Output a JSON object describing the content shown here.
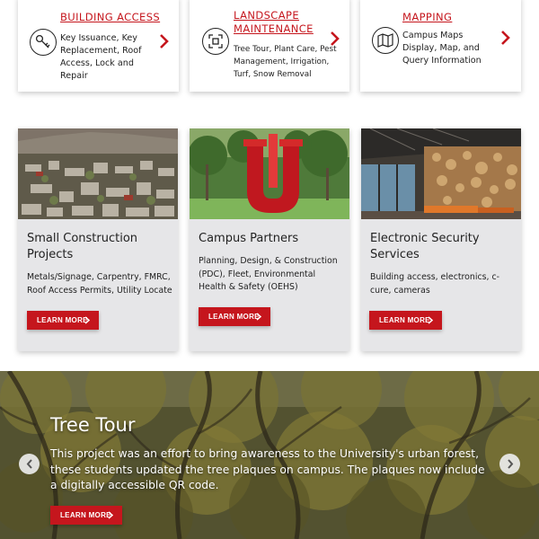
{
  "services": [
    {
      "title": "BUILDING ACCESS",
      "description": "Key Issuance, Key Replacement, Roof Access, Lock and Repair",
      "icon": "key-icon"
    },
    {
      "title": "LANDSCAPE MAINTENANCE",
      "description": "Tree Tour, Plant Care, Pest Management, Irrigation, Turf, Snow Removal",
      "icon": "focus-frame-icon"
    },
    {
      "title": "MAPPING",
      "description": "Campus Maps Display, Map, and Query Information",
      "icon": "map-icon"
    }
  ],
  "features": [
    {
      "title": "Small Construction Projects",
      "description": "Metals/Signage, Carpentry, FMRC, Roof Access Permits, Utility Locate",
      "button": "LEARN MORE"
    },
    {
      "title": "Campus Partners",
      "description": "Planning, Design, & Construction (PDC), Fleet, Environmental Health & Safety (OEHS)",
      "button": "LEARN MORE"
    },
    {
      "title": "Electronic Security Services",
      "description": "Building access, electronics, c-cure, cameras",
      "button": "LEARN MORE"
    }
  ],
  "hero": {
    "title": "Tree Tour",
    "description": "This project was an effort to bring awareness to the University's urban forest, these students updated the tree plaques on campus. The plaques now include a digitally accessible QR code.",
    "button": "LEARN MORE",
    "prev_icon": "chevron-left-icon",
    "next_icon": "chevron-right-icon"
  },
  "colors": {
    "accent": "#c5161d",
    "card_bg": "#e6e6e8"
  }
}
